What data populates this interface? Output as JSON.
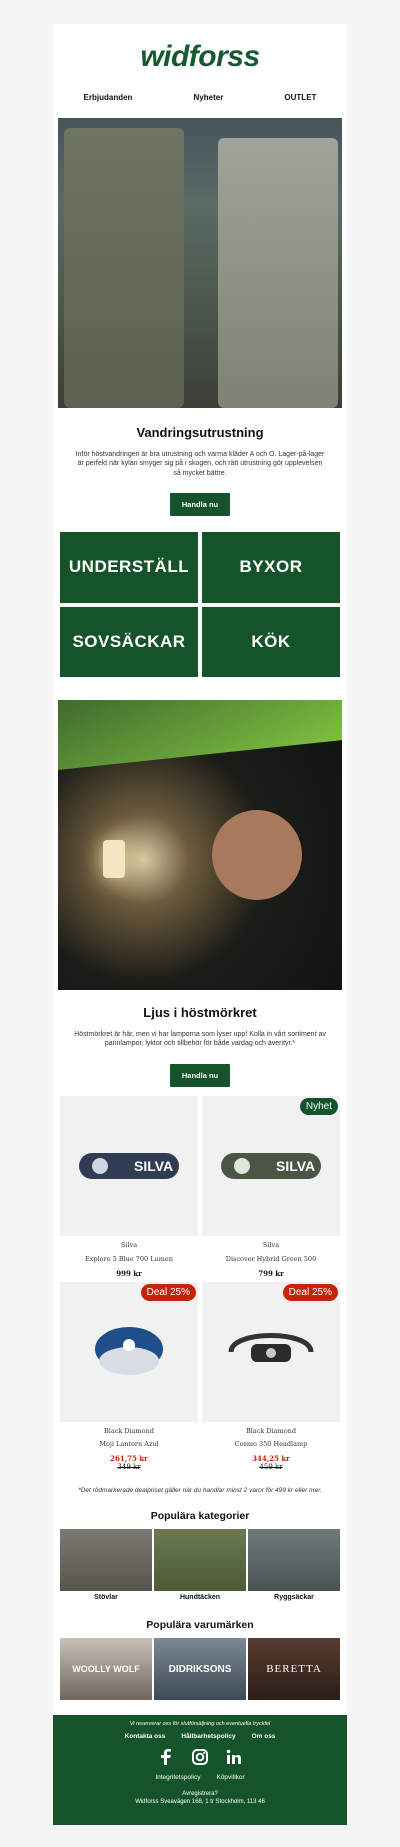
{
  "brand": {
    "logo_text": "widforss"
  },
  "nav": [
    "Erbjudanden",
    "Nyheter",
    "OUTLET"
  ],
  "hero": {
    "title": "Vandringsutrustning",
    "text": "Inför höstvandringen är bra utrustning och varma kläder A och O. Lager-på-lager är perfekt när kylan smyger sig på i skogen, och rätt utrustning gör upplevelsen så mycket bättre.",
    "button": "Handla nu"
  },
  "tiles": [
    "UNDERSTÄLL",
    "BYXOR",
    "SOVSÄCKAR",
    "KÖK"
  ],
  "section2": {
    "title": "Ljus i höstmörkret",
    "text": "Höstmörkret är här, men vi har lamporna som lyser upp! Kolla in vårt sortiment av pannlampor, lyktor och tillbehör för både vardag och äventyr.*",
    "button": "Handla nu"
  },
  "products": [
    {
      "brand": "Silva",
      "name": "Explore 5 Blue 700 Lumen",
      "price": "999 kr",
      "old_price": "",
      "badge": ""
    },
    {
      "brand": "Silva",
      "name": "Discover Hybrid Green 500",
      "price": "799 kr",
      "old_price": "",
      "badge": "Nyhet"
    },
    {
      "brand": "Black Diamond",
      "name": "Moji Lantern Azul",
      "price": "261,75 kr",
      "old_price": "349 kr",
      "badge": "Deal 25%"
    },
    {
      "brand": "Black Diamond",
      "name": "Cosmo 350 Headlamp",
      "price": "344,25 kr",
      "old_price": "459 kr",
      "badge": "Deal 25%"
    }
  ],
  "deal_note": "*Det rödmarkerade dealpriset gäller när du handlar minst 2 varor för 499 kr eller mer.",
  "categories": {
    "title": "Populära kategorier",
    "items": [
      "Stövlar",
      "Hundtäcken",
      "Ryggsäckar"
    ]
  },
  "brands": {
    "title": "Populära varumärken",
    "items": [
      "WOOLLY WOLF",
      "DIDRIKSONS",
      "BERETTA"
    ]
  },
  "footer": {
    "note": "Vi reserverar oss för slutförsäljning och eventuella tryckfel",
    "links": [
      "Kontakta oss",
      "Hållbarhetspolicy",
      "Om oss"
    ],
    "links2": [
      "Integritetspolicy",
      "Köpvillkor"
    ],
    "unsubscribe": "Avregistrera?",
    "address": "Widforss Sveavägen 168, 1 tr Stockholm, 113 46"
  },
  "colors": {
    "brand_green": "#15532a",
    "deal_red": "#c4240b",
    "bg": "#f5f5f5"
  }
}
